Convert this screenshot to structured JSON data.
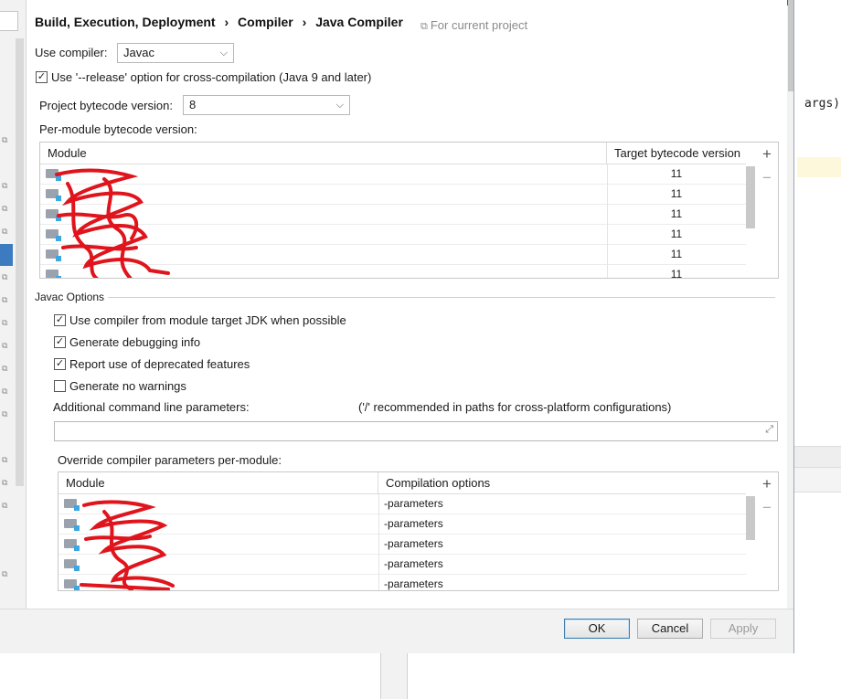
{
  "editor": {
    "code_fragment": "args)"
  },
  "breadcrumb": {
    "part1": "Build, Execution, Deployment",
    "sep": "›",
    "part2": "Compiler",
    "part3": "Java Compiler",
    "scope_label": "For current project"
  },
  "compiler": {
    "use_compiler_label": "Use compiler:",
    "use_compiler_value": "Javac",
    "release_option_label": "Use '--release' option for cross-compilation (Java 9 and later)",
    "release_option_checked": true,
    "project_bytecode_label": "Project bytecode version:",
    "project_bytecode_value": "8",
    "per_module_label": "Per-module bytecode version:"
  },
  "module_table": {
    "col_module": "Module",
    "col_target": "Target bytecode version",
    "rows": [
      {
        "module": "",
        "target": "11"
      },
      {
        "module": "",
        "target": "11"
      },
      {
        "module": "",
        "target": "11"
      },
      {
        "module": "",
        "target": "11"
      },
      {
        "module": "",
        "target": "11"
      },
      {
        "module": "",
        "target": "11"
      }
    ],
    "add_label": "+",
    "remove_label": "−"
  },
  "javac": {
    "section_title": "Javac Options",
    "options": [
      {
        "label": "Use compiler from module target JDK when possible",
        "checked": true
      },
      {
        "label": "Generate debugging info",
        "checked": true
      },
      {
        "label": "Report use of deprecated features",
        "checked": true
      },
      {
        "label": "Generate no warnings",
        "checked": false
      }
    ],
    "additional_params_label": "Additional command line parameters:",
    "additional_params_hint": "('/' recommended in paths for cross-platform configurations)",
    "additional_params_value": "",
    "override_label": "Override compiler parameters per-module:"
  },
  "override_table": {
    "col_module": "Module",
    "col_options": "Compilation options",
    "rows": [
      {
        "module": "",
        "options": "-parameters"
      },
      {
        "module": "",
        "options": "-parameters"
      },
      {
        "module": "",
        "options": "-parameters"
      },
      {
        "module": "",
        "options": "-parameters"
      },
      {
        "module": "",
        "options": "-parameters"
      }
    ],
    "add_label": "+",
    "remove_label": "−"
  },
  "footer": {
    "ok": "OK",
    "cancel": "Cancel",
    "apply": "Apply"
  },
  "colors": {
    "redaction": "#e0141c",
    "selection": "#3c7bbf"
  }
}
